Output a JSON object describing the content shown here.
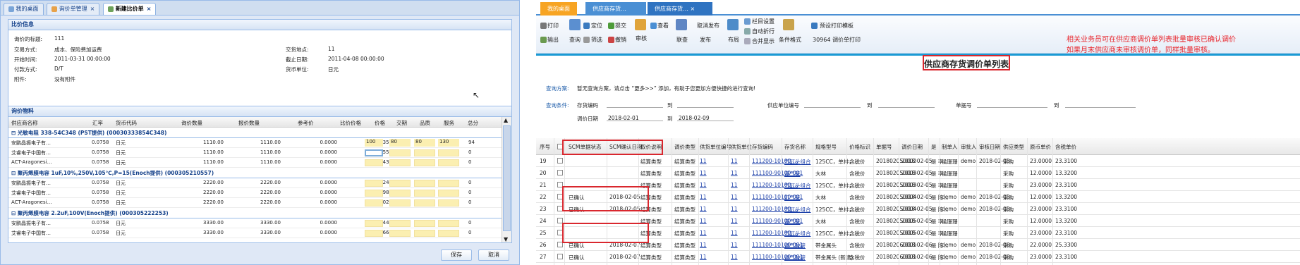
{
  "left": {
    "tabs": [
      "我的桌面",
      "询价单管理",
      "新建比价单"
    ],
    "info_header": "比价信息",
    "fields": {
      "title_label": "询价的标题:",
      "title_value": "111",
      "trade_label": "交易方式:",
      "trade_value": "成本、保险费加运费",
      "place_label": "交货地点:",
      "place_value": "11",
      "start_label": "开始时间:",
      "start_value": "2011-03-31 00:00:00",
      "end_label": "截止日期:",
      "end_value": "2011-04-08 00:00:00",
      "pay_label": "付款方式:",
      "pay_value": "D/T",
      "cur_label": "货币单位:",
      "cur_value": "日元",
      "attach_label": "附件:",
      "attach_value": "没有附件"
    },
    "items_header": "询价物料",
    "columns": [
      "供应商名称",
      "汇率",
      "货币代码",
      "询价数量",
      "报价数量",
      "参考价",
      "比价价格",
      "价格",
      "交期",
      "品质",
      "服务",
      "总分"
    ],
    "groups": [
      {
        "title": "光敏电阻 338-54C348 (PST提供) (00030333854C348)",
        "rows": [
          [
            "安鹏晶振电子有…",
            "0.0758",
            "日元",
            "1110.00",
            "1110.00",
            "0.0000",
            "0.4350",
            "100",
            "80",
            "80",
            "130",
            "94"
          ],
          [
            "艾睿电子中国有…",
            "0.0758",
            "日元",
            "1110.00",
            "1110.00",
            "0.0000",
            "0.6556",
            "",
            "",
            "",
            "",
            "0"
          ],
          [
            "ACT-Aragonesi…",
            "0.0758",
            "日元",
            "1110.00",
            "1110.00",
            "0.0000",
            "0.8430",
            "",
            "",
            "",
            "",
            "0"
          ]
        ]
      },
      {
        "title": "聚丙烯膜电容 1uF,10%,250V,105℃,P=15(Enoch提供) (000305210557)",
        "rows": [
          [
            "安鹏晶振电子有…",
            "0.0758",
            "日元",
            "2220.00",
            "2220.00",
            "0.0000",
            "1.3240",
            "",
            "",
            "",
            "",
            "0"
          ],
          [
            "艾睿电子中国有…",
            "0.0758",
            "日元",
            "2220.00",
            "2220.00",
            "0.0000",
            "1.0980",
            "",
            "",
            "",
            "",
            "0"
          ],
          [
            "ACT-Aragonesi…",
            "0.0758",
            "日元",
            "2220.00",
            "2220.00",
            "0.0000",
            "1.3020",
            "",
            "",
            "",
            "",
            "0"
          ]
        ]
      },
      {
        "title": "聚丙烯膜电容 2.2uF,100V(Enoch提供) (000305222253)",
        "rows": [
          [
            "安鹏晶振电子有…",
            "0.0758",
            "日元",
            "3330.00",
            "3330.00",
            "0.0000",
            "0.8440",
            "",
            "",
            "",
            "",
            "0"
          ],
          [
            "艾睿电子中国有…",
            "0.0758",
            "日元",
            "3330.00",
            "3330.00",
            "0.0000",
            "0.7660",
            "",
            "",
            "",
            "",
            "0"
          ]
        ]
      }
    ],
    "save": "保存",
    "cancel": "取消"
  },
  "right": {
    "tabs": [
      "我的桌面",
      "供应商存货…",
      "供应商存货…"
    ],
    "toolbar": {
      "print": "打印",
      "output": "输出",
      "locate": "定位",
      "query": "查询",
      "filter": "筛选",
      "submit": "提交",
      "revoke": "撤销",
      "audit": "审核",
      "view": "查看",
      "chain": "联查",
      "cancel_pub": "取消发布",
      "publish": "发布",
      "layout": "布局",
      "col_set": "栏目设置",
      "auto_wrap": "自动折行",
      "merge": "合并显示",
      "cond_fmt": "条件格式",
      "print_tpl": "预设打印模板",
      "tpl_name": "30964 调价单打印"
    },
    "note1": "相关业务员可在供应商调价单列表批量审核已确认调价",
    "note2": "如果月末供应商未审核调价单，同样批量审核。",
    "page_title": "供应商存货调价单列表",
    "scheme_label": "查询方案:",
    "scheme_text": "暂无查询方案，请点击 “更多>>” 添加，有助于您更加方便快捷的进行查询!",
    "cond_label": "查询条件:",
    "inv_code": "存货编码",
    "to": "到",
    "supplier_code": "供应单位编号",
    "doc_no": "单据号",
    "adj_date": "调价日期",
    "date_from": "2018-02-01",
    "date_to": "2018-02-09",
    "columns": [
      "序号",
      "",
      "SCM单据状态",
      "SCM确认日期",
      "取价说明",
      "调价类型",
      "供货单位编号",
      "供货单位",
      "存货编码",
      "存货名称",
      "规格型号",
      "价格标识",
      "单据号",
      "调价日期",
      "是",
      "制单人",
      "审批人",
      "审核日期",
      "供应类型",
      "原币单价",
      "含税单价"
    ],
    "rows": [
      [
        "19",
        "",
        "",
        "",
        "结算类型",
        "结算类型",
        "11",
        "11",
        "111200-10100-…",
        "气缸头组合",
        "125CC，单排，…",
        "含税价",
        "201802050002",
        "2018-02-05",
        "是 李…",
        "侯珊珊",
        "demo",
        "2018-02-05",
        "采购",
        "23.0000",
        "23.3100"
      ],
      [
        "20",
        "",
        "",
        "",
        "结算类型",
        "结算类型",
        "11",
        "11",
        "111100-90100-001",
        "蓬气管",
        "大林",
        "含税价",
        "201802050003",
        "2018-02-05",
        "是 李…",
        "侯珊珊",
        "",
        "",
        "采购",
        "12.0000",
        "13.3200"
      ],
      [
        "21",
        "",
        "",
        "",
        "结算类型",
        "结算类型",
        "11",
        "11",
        "111200-10100-…",
        "气缸头组合",
        "125CC，单排，…",
        "含税价",
        "201802050003",
        "2018-02-05",
        "是 李…",
        "侯珊珊",
        "",
        "",
        "采购",
        "23.0000",
        "23.3100"
      ],
      [
        "22",
        "",
        "已确认",
        "2018-02-05",
        "结算类型",
        "结算类型",
        "11",
        "11",
        "111100-10100-001",
        "缸气管",
        "大林",
        "含税价",
        "201802050004",
        "2018-02-05",
        "是 陈…",
        "demo",
        "demo",
        "2018-02-05",
        "采购",
        "12.0000",
        "13.3200"
      ],
      [
        "23",
        "",
        "已确认",
        "2018-02-05",
        "结算类型",
        "结算类型",
        "11",
        "11",
        "111200-10100-…",
        "气缸头组合",
        "125CC，单排，…",
        "含税价",
        "201802050004",
        "2018-02-05",
        "是 陈…",
        "demo",
        "demo",
        "2018-02-05",
        "采购",
        "23.0000",
        "23.3100"
      ],
      [
        "24",
        "",
        "",
        "",
        "结算类型",
        "结算类型",
        "11",
        "11",
        "111100-90100-001",
        "蓬气管",
        "大林",
        "含税价",
        "201802050005",
        "2018-02-05",
        "是 李…",
        "侯珊珊",
        "",
        "",
        "采购",
        "12.0000",
        "13.3200"
      ],
      [
        "25",
        "",
        "",
        "",
        "结算类型",
        "结算类型",
        "11",
        "11",
        "111200-10100-…",
        "气缸头组合",
        "125CC，单排，…",
        "含税价",
        "201802050005",
        "2018-02-05",
        "是 李…",
        "侯珊珊",
        "",
        "",
        "采购",
        "23.0000",
        "23.3100"
      ],
      [
        "26",
        "",
        "已确认",
        "2018-02-07",
        "结算类型",
        "结算类型",
        "11",
        "11",
        "111100-10100-001",
        "通气胶管",
        "带金属头",
        "含税价",
        "201802060001",
        "2018-02-06",
        "是 陈…",
        "demo",
        "demo",
        "2018-02-06",
        "采购",
        "22.0000",
        "25.3300"
      ],
      [
        "27",
        "",
        "已确认",
        "2018-02-07",
        "结算类型",
        "结算类型",
        "11",
        "11",
        "111100-10100-001",
        "通气胶管",
        "带金属头 (新建)",
        "含税价",
        "201802060001",
        "2018-02-06",
        "是 陈…",
        "demo",
        "demo",
        "2018-02-06",
        "采购",
        "23.0000",
        "23.3100"
      ]
    ]
  },
  "colors": {
    "accent": "#d9272e",
    "ext_blue": "#15428b",
    "tab_orange": "#f7a423",
    "tab_blue": "#4a8fd4"
  }
}
